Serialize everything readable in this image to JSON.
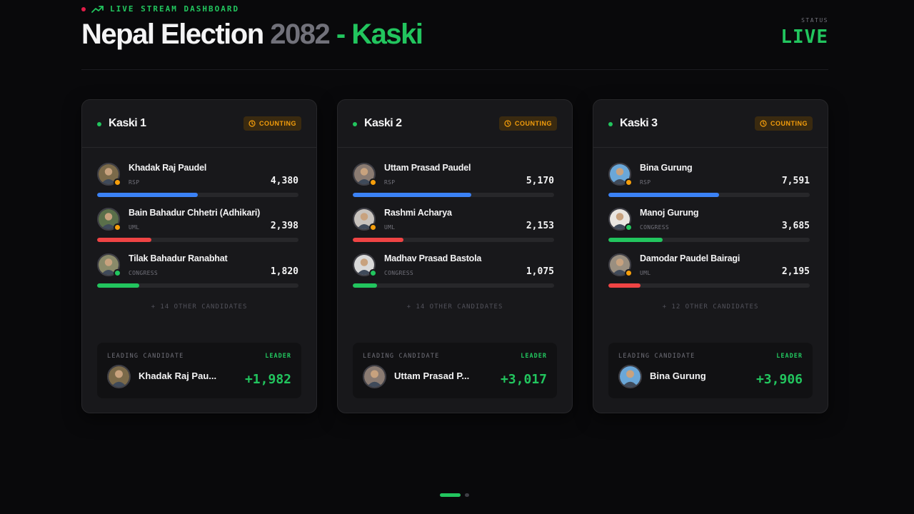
{
  "header": {
    "eyebrow": "LIVE STREAM DASHBOARD",
    "title_main": "Nepal Election",
    "title_year": "2082",
    "title_region": "- Kaski",
    "status_label": "STATUS",
    "status_value": "LIVE"
  },
  "colors": {
    "accent_green": "#22c55e",
    "counting_amber": "#f59e0b",
    "rsp_blue": "#3b82f6",
    "uml_red": "#ef4444",
    "congress_green": "#22c55e"
  },
  "cards": [
    {
      "name": "Kaski 1",
      "badge": "COUNTING",
      "candidates": [
        {
          "name": "Khadak Raj Paudel",
          "party": "RSP",
          "votes": "4,380",
          "share": 0.5,
          "color": "#3b82f6",
          "badge_color": "#f59e0b"
        },
        {
          "name": "Bain Bahadur Chhetri (Adhikari)",
          "party": "UML",
          "votes": "2,398",
          "share": 0.27,
          "color": "#ef4444",
          "badge_color": "#f59e0b"
        },
        {
          "name": "Tilak Bahadur Ranabhat",
          "party": "CONGRESS",
          "votes": "1,820",
          "share": 0.21,
          "color": "#22c55e",
          "badge_color": "#22c55e"
        }
      ],
      "others": "+ 14 OTHER CANDIDATES",
      "leading": {
        "label": "LEADING CANDIDATE",
        "tag": "LEADER",
        "name": "Khadak Raj Pau...",
        "margin": "+1,982"
      }
    },
    {
      "name": "Kaski 2",
      "badge": "COUNTING",
      "candidates": [
        {
          "name": "Uttam Prasad Paudel",
          "party": "RSP",
          "votes": "5,170",
          "share": 0.59,
          "color": "#3b82f6",
          "badge_color": "#f59e0b"
        },
        {
          "name": "Rashmi Acharya",
          "party": "UML",
          "votes": "2,153",
          "share": 0.25,
          "color": "#ef4444",
          "badge_color": "#f59e0b"
        },
        {
          "name": "Madhav Prasad Bastola",
          "party": "CONGRESS",
          "votes": "1,075",
          "share": 0.12,
          "color": "#22c55e",
          "badge_color": "#22c55e"
        }
      ],
      "others": "+ 14 OTHER CANDIDATES",
      "leading": {
        "label": "LEADING CANDIDATE",
        "tag": "LEADER",
        "name": "Uttam Prasad P...",
        "margin": "+3,017"
      }
    },
    {
      "name": "Kaski 3",
      "badge": "COUNTING",
      "candidates": [
        {
          "name": "Bina Gurung",
          "party": "RSP",
          "votes": "7,591",
          "share": 0.55,
          "color": "#3b82f6",
          "badge_color": "#f59e0b"
        },
        {
          "name": "Manoj Gurung",
          "party": "CONGRESS",
          "votes": "3,685",
          "share": 0.27,
          "color": "#22c55e",
          "badge_color": "#22c55e"
        },
        {
          "name": "Damodar Paudel Bairagi",
          "party": "UML",
          "votes": "2,195",
          "share": 0.16,
          "color": "#ef4444",
          "badge_color": "#f59e0b"
        }
      ],
      "others": "+ 12 OTHER CANDIDATES",
      "leading": {
        "label": "LEADING CANDIDATE",
        "tag": "LEADER",
        "name": "Bina Gurung",
        "margin": "+3,906"
      }
    }
  ],
  "pager": {
    "pages": 2,
    "active": 1
  }
}
